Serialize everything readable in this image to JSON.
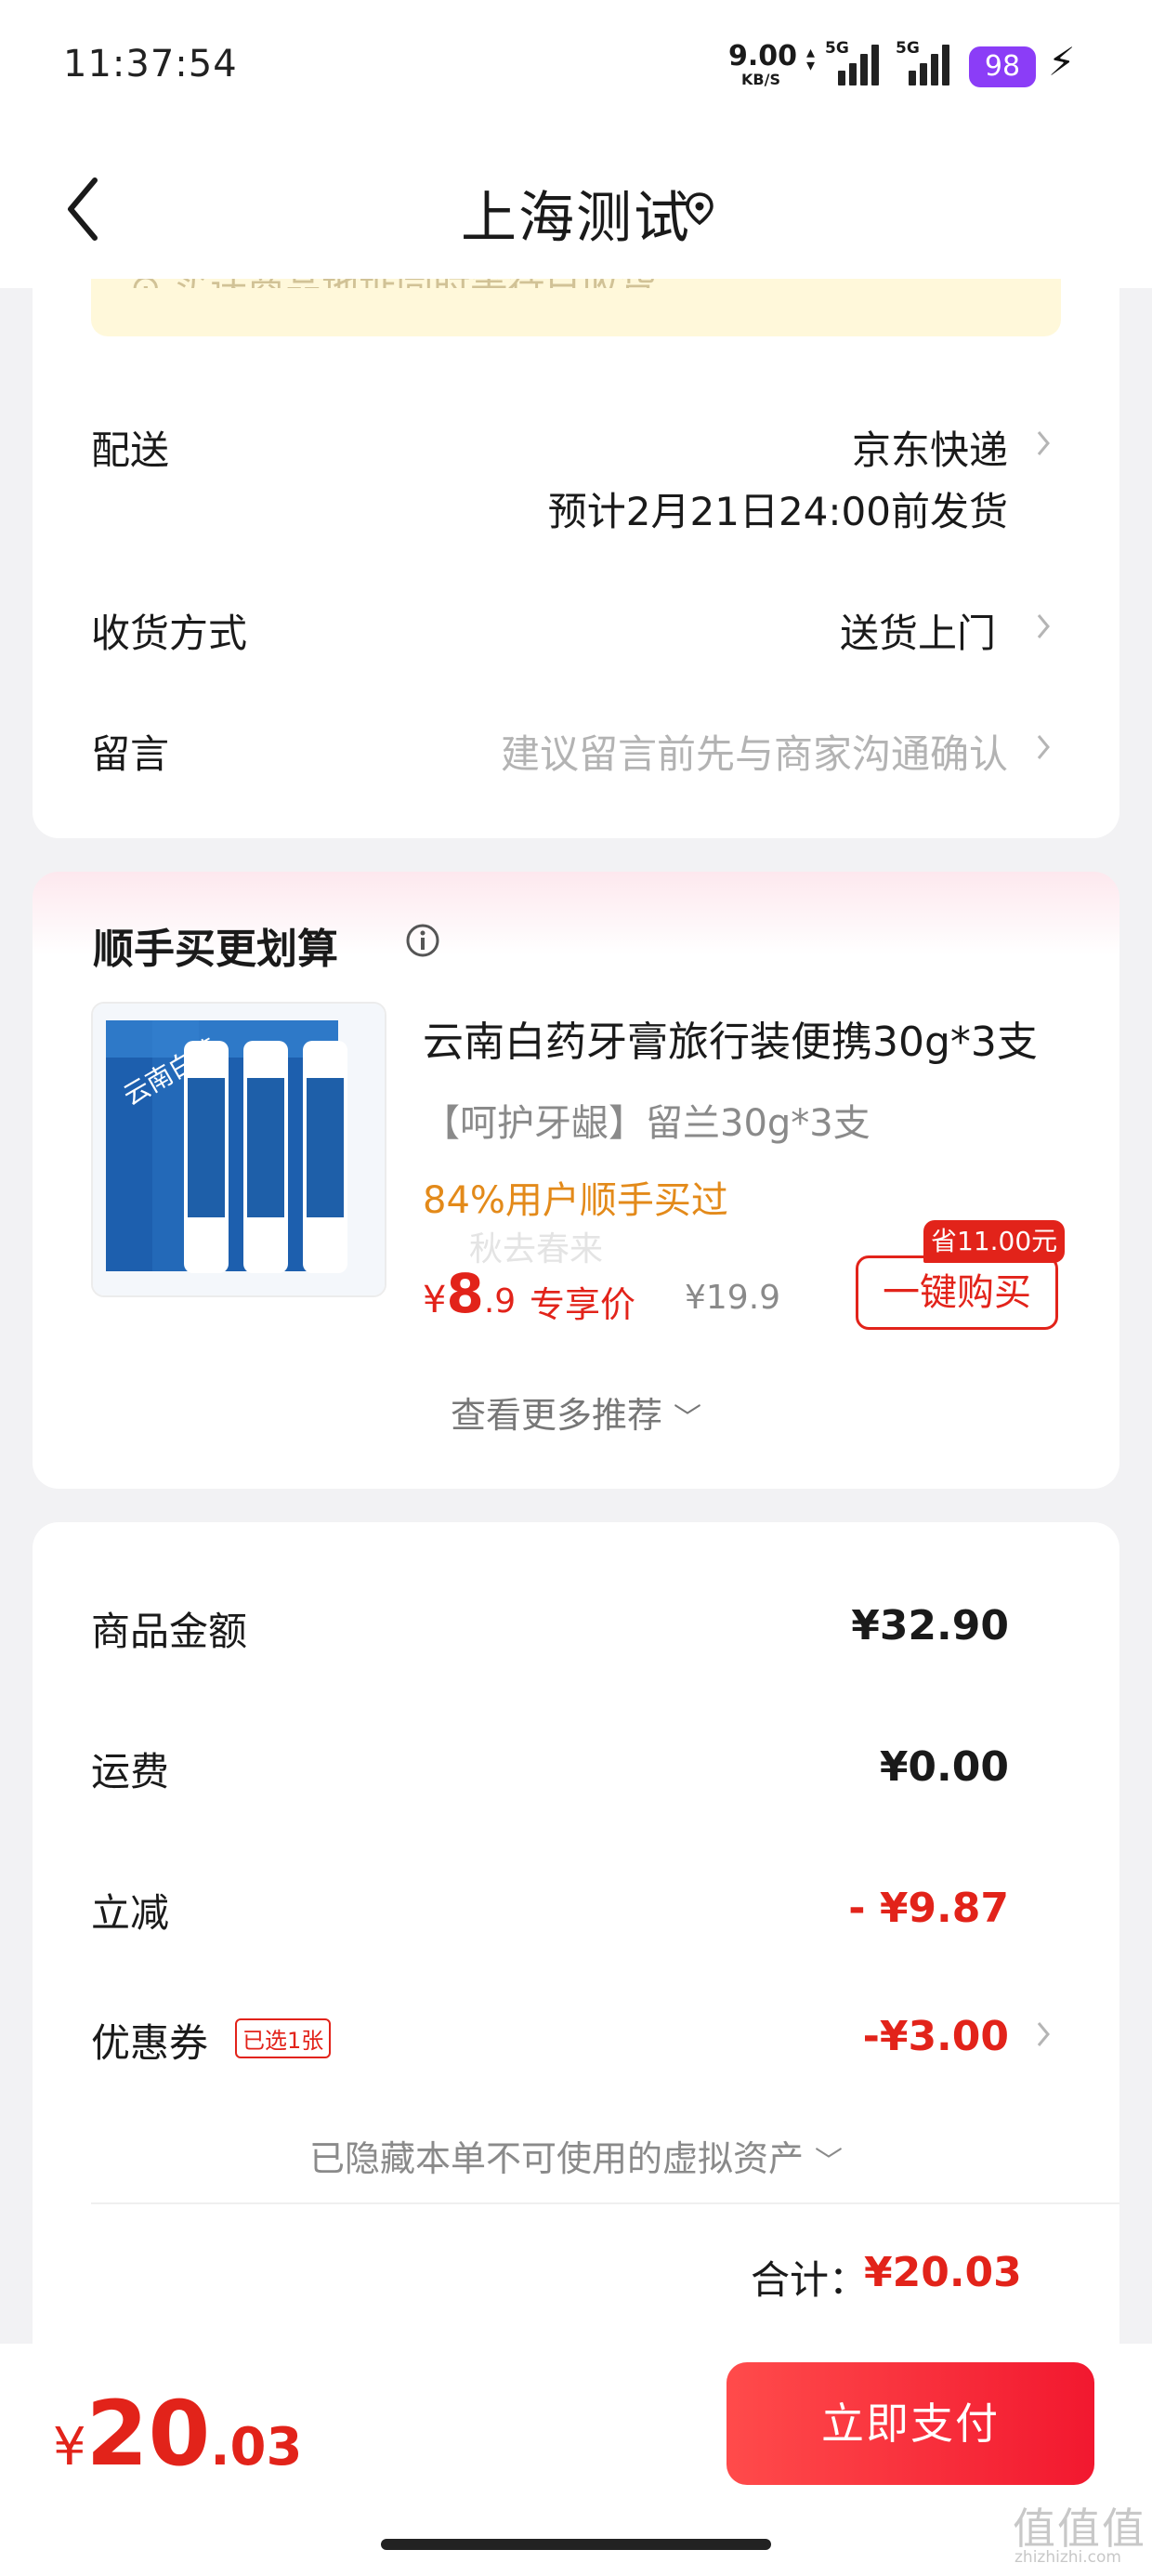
{
  "status_bar": {
    "time": "11:37:54",
    "net_speed": "9.00",
    "net_unit": "KB/S",
    "sim1": "5G",
    "sim2": "5G",
    "battery": "98"
  },
  "nav": {
    "title": "上海测试",
    "back_icon": "chevron-left-icon",
    "location_icon": "location-pin-icon"
  },
  "notice": {
    "text": "⊙ 买送商品地址同时等待已收货"
  },
  "delivery": {
    "shipping_label": "配送",
    "shipping_value": "京东快递",
    "shipping_eta": "预计2月21日24:00前发货",
    "receive_label": "收货方式",
    "receive_value": "送货上门",
    "note_label": "留言",
    "note_placeholder": "建议留言前先与商家沟通确认"
  },
  "addon": {
    "title": "顺手买更划算",
    "info_icon": "info-icon",
    "product": {
      "name": "云南白药牙膏旅行装便携30g*3支",
      "spec": "【呵护牙龈】留兰30g*3支",
      "tip": "84%用户顺手买过",
      "watermark": "秋去春来",
      "price_symbol": "¥",
      "price_int": "8",
      "price_dec": ".9",
      "price_tag": "专享价",
      "original_price": "¥19.9",
      "save_badge": "省11.00元",
      "buy_label": "一键购买",
      "thumb_brand": "云南白药"
    },
    "more_label": "查看更多推荐"
  },
  "summary": {
    "goods_label": "商品金额",
    "goods_value": "¥32.90",
    "freight_label": "运费",
    "freight_value": "¥0.00",
    "discount_label": "立减",
    "discount_value": "- ¥9.87",
    "coupon_label": "优惠券",
    "coupon_badge": "已选1张",
    "coupon_value": "-¥3.00",
    "hidden_assets": "已隐藏本单不可使用的虚拟资产",
    "total_label": "合计：",
    "total_value": "¥20.03"
  },
  "bottom_bar": {
    "symbol": "¥",
    "amount_int": "20",
    "amount_dec": ".03",
    "pay_label": "立即支付"
  },
  "watermark_site": {
    "mark": "值值值",
    "url": "zhizhizhi.com"
  },
  "colors": {
    "accent_red": "#e2231a",
    "tip_orange": "#e38a1a",
    "battery_purple": "#8b3df7"
  }
}
